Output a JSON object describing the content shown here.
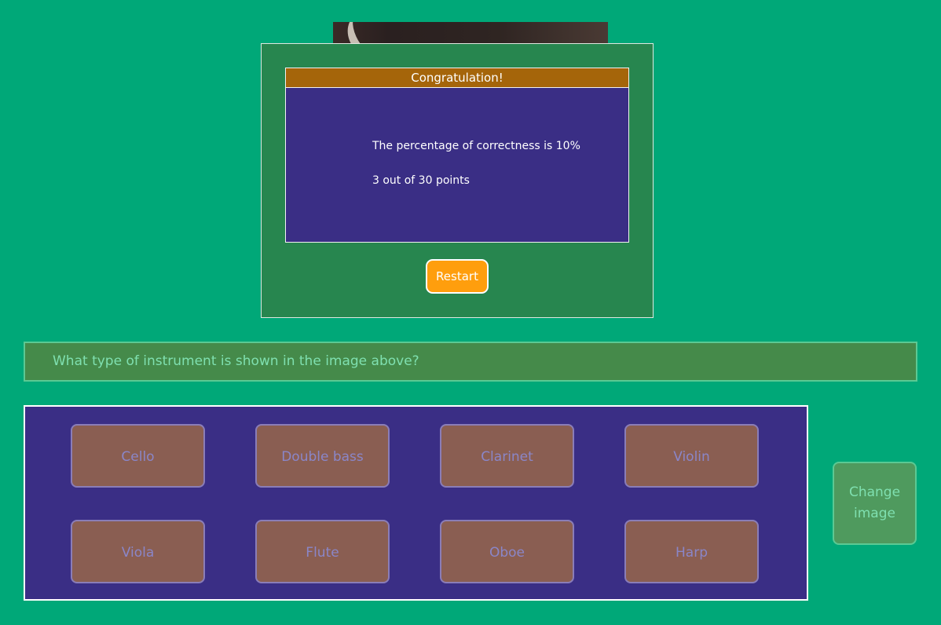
{
  "modal": {
    "title": "Congratulation!",
    "percentage_text": "The percentage of correctness is 10%",
    "points_text": "3 out of 30 points",
    "restart_label": "Restart"
  },
  "question": {
    "text": "What type of instrument is shown in the image above?"
  },
  "answers": [
    {
      "label": "Cello"
    },
    {
      "label": "Double bass"
    },
    {
      "label": "Clarinet"
    },
    {
      "label": "Violin"
    },
    {
      "label": "Viola"
    },
    {
      "label": "Flute"
    },
    {
      "label": "Oboe"
    },
    {
      "label": "Harp"
    }
  ],
  "change_image": {
    "label": "Change image"
  },
  "colors": {
    "background": "#00a878",
    "modal_bg": "#27864f",
    "header_bg": "#a5650a",
    "panel_bg": "#3a2e85",
    "restart_bg": "#ff9e0d",
    "answer_bg": "#8a5e52",
    "question_bg": "#458a4a"
  }
}
